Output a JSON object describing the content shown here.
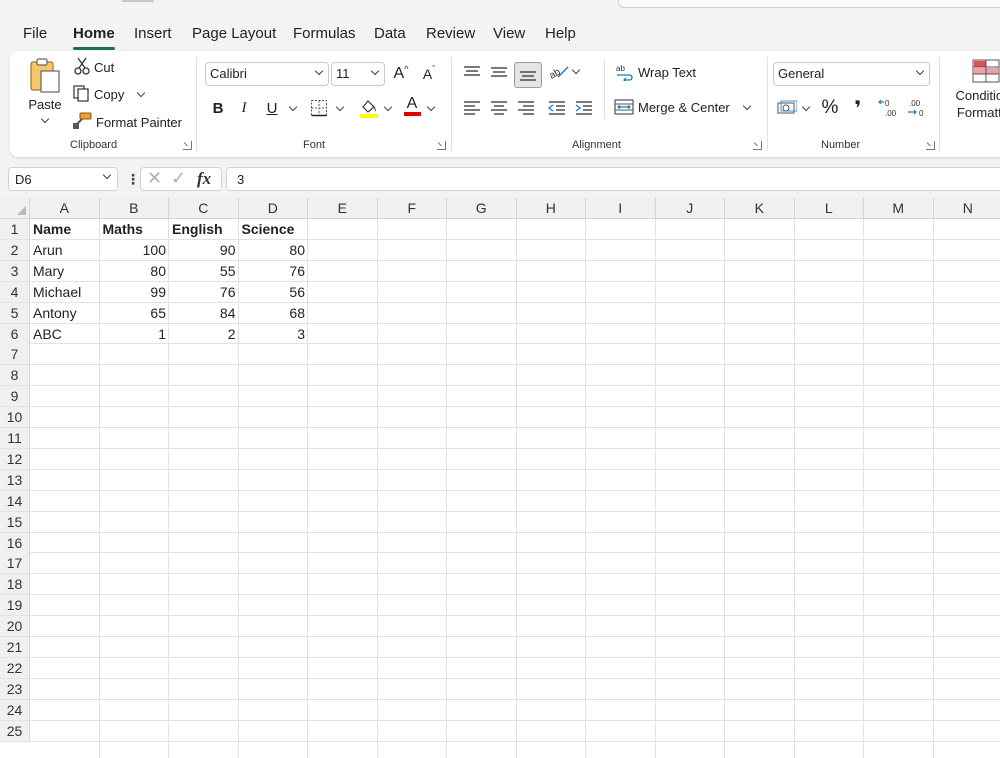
{
  "menu": {
    "tabs": [
      {
        "label": "File"
      },
      {
        "label": "Home"
      },
      {
        "label": "Insert"
      },
      {
        "label": "Page Layout"
      },
      {
        "label": "Formulas"
      },
      {
        "label": "Data"
      },
      {
        "label": "Review"
      },
      {
        "label": "View"
      },
      {
        "label": "Help"
      }
    ],
    "active": "Home"
  },
  "ribbon": {
    "clipboard": {
      "label": "Clipboard",
      "paste": "Paste",
      "cut": "Cut",
      "copy": "Copy",
      "format_painter": "Format Painter"
    },
    "font": {
      "label": "Font",
      "font_name": "Calibri",
      "font_size": "11",
      "bold": "B",
      "italic": "I",
      "underline": "U",
      "grow_glyph": "A",
      "shrink_glyph": "A",
      "font_color_glyph": "A",
      "fill_color": "#ffff00",
      "font_color": "#e00000"
    },
    "alignment": {
      "label": "Alignment",
      "wrap_text": "Wrap Text",
      "merge_center": "Merge & Center"
    },
    "number": {
      "label": "Number",
      "format": "General",
      "percent": "%",
      "comma": "❜"
    },
    "styles": {
      "conditional_formatting": "Conditional Formatting"
    }
  },
  "formula_bar": {
    "name_box": "D6",
    "fx": "fx",
    "formula": "3"
  },
  "sheet": {
    "columns": [
      "A",
      "B",
      "C",
      "D",
      "E",
      "F",
      "G",
      "H",
      "I",
      "J",
      "K",
      "L",
      "M",
      "N"
    ],
    "rows": [
      "1",
      "2",
      "3",
      "4",
      "5",
      "6",
      "7",
      "8",
      "9",
      "10",
      "11",
      "12",
      "13",
      "14",
      "15",
      "16",
      "17",
      "18",
      "19",
      "20",
      "21",
      "22",
      "23",
      "24",
      "25"
    ],
    "header": [
      "Name",
      "Maths",
      "English",
      "Science"
    ],
    "data": [
      [
        "Arun",
        "100",
        "90",
        "80"
      ],
      [
        "Mary",
        "80",
        "55",
        "76"
      ],
      [
        "Michael",
        "99",
        "76",
        "56"
      ],
      [
        "Antony",
        "65",
        "84",
        "68"
      ],
      [
        "ABC",
        "1",
        "2",
        "3"
      ]
    ]
  },
  "colors": {
    "accent": "#1e7145"
  }
}
